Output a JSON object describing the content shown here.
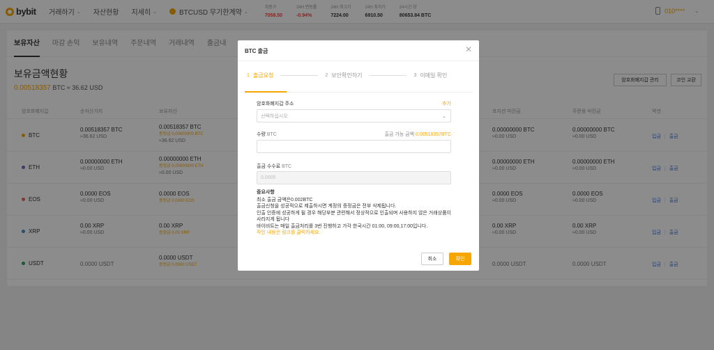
{
  "nav": {
    "logo": "bybit",
    "items": [
      "거래하기",
      "자산현황",
      "지세히"
    ],
    "symbol": "BTCUSD 무기한계약",
    "ticker": [
      {
        "label": "최종가",
        "value": "7058.50",
        "color": "red"
      },
      {
        "label": "24H 변동률",
        "value": "-0.94%",
        "color": "red"
      },
      {
        "label": "24H 최고가",
        "value": "7224.00",
        "color": ""
      },
      {
        "label": "24H 최저가",
        "value": "6910.50",
        "color": ""
      },
      {
        "label": "24시간 양",
        "value": "80653.84 BTC",
        "color": ""
      }
    ],
    "user": "010****"
  },
  "tabs": [
    "보유자산",
    "마감 손익",
    "보유내역",
    "주문내역",
    "거래내역",
    "출금내"
  ],
  "section": {
    "title": "보유금액현황",
    "total_btc": "0.00518357",
    "total_rest": "BTC ≈ 36.62 USD",
    "btn_wallet": "암호화폐지갑 관리",
    "btn_coin": "코인 교환"
  },
  "table": {
    "headers": [
      "암호화폐지갑",
      "순자산가치",
      "보유자산",
      "포지션 마진금",
      "주문용 마진금",
      "약션"
    ],
    "rows": [
      {
        "coin": "BTC",
        "dot": "#f7a600",
        "nav": "0.00518357 BTC",
        "nav_usd": "≈36.62 USD",
        "hold": "0.00518357 BTC",
        "hold_sub": "증정금 0.00000000 BTC",
        "hold_usd": "≈36.62 USD",
        "pos": "0.00000000 BTC",
        "pos_usd": "≈0.00 USD",
        "ord": "0.00000000 BTC",
        "ord_usd": "≈0.00 USD"
      },
      {
        "coin": "ETH",
        "dot": "#6a6fb8",
        "nav": "0.00000000 ETH",
        "nav_usd": "≈0.00 USD",
        "hold": "0.00000000 ETH",
        "hold_sub": "증정금 0.00000000 ETH",
        "hold_usd": "≈0.00 USD",
        "pos": "0.00000000 ETH",
        "pos_usd": "≈0.00 USD",
        "ord": "0.00000000 ETH",
        "ord_usd": "≈0.00 USD"
      },
      {
        "coin": "EOS",
        "dot": "#e0685a",
        "nav": "0.0000 EOS",
        "nav_usd": "≈0.00 USD",
        "hold": "0.0000 EOS",
        "hold_sub": "증정금 0.0000 EOS",
        "hold_usd": "",
        "pos": "0.0000 EOS",
        "pos_usd": "≈0.00 USD",
        "ord": "0.0000 EOS",
        "ord_usd": "≈0.00 USD"
      },
      {
        "coin": "XRP",
        "dot": "#4a8fc9",
        "nav": "0.00 XRP",
        "nav_usd": "≈0.00 USD",
        "hold": "0.00 XRP",
        "hold_sub": "증정금 0.00 XRP",
        "hold_usd": "",
        "pos": "0.00 XRP",
        "pos_usd": "≈0.00 USD",
        "ord": "0.00 XRP",
        "ord_usd": "≈0.00 USD"
      },
      {
        "coin": "USDT",
        "dot": "#2ea05a",
        "nav": "0.0000 USDT",
        "nav_usd": "",
        "hold": "0.0000 USDT",
        "hold_sub": "증정금 0.0000 USDT",
        "hold_usd": "",
        "pos": "0.0000 USDT",
        "pos_usd": "",
        "ord": "0.0000 USDT",
        "ord_usd": ""
      }
    ],
    "deposit": "입금",
    "withdraw": "출금"
  },
  "modal": {
    "title": "BTC 출금",
    "steps": [
      {
        "num": "1",
        "label": "출금요청"
      },
      {
        "num": "2",
        "label": "보안확인하기"
      },
      {
        "num": "3",
        "label": "이메일 확인"
      }
    ],
    "address_label": "암호화폐지갑 주소",
    "address_add": "추가",
    "address_placeholder": "선택하십시오",
    "qty_label": "수량",
    "qty_unit": "BTC",
    "available_label": "출금 가능 금액",
    "available_value": "0.00518357BTC",
    "fee_label": "출금 수수료",
    "fee_unit": "BTC",
    "fee_value": "0.0005",
    "notes_title": "중요사항",
    "notes": [
      "최소 출금 금액은0.002BTC",
      "출금신청을 성공적으로 제출하시면 계정의 증정금은 전부 삭제됩니다.",
      "인출 인증에 성공하게 될 경우 해당부분 관련해서 정상적으로 인출되며 사용하지 않은 거래상품이 사라지게 됩니다",
      "바이비트는 매일 출금처리를 3번 진행하고 가각 한국시간 01:00, 09:00,17:00입니다."
    ],
    "notes_link": "작인 내용은 링크를 클릭하세요.",
    "cancel": "취소",
    "confirm": "확인"
  }
}
